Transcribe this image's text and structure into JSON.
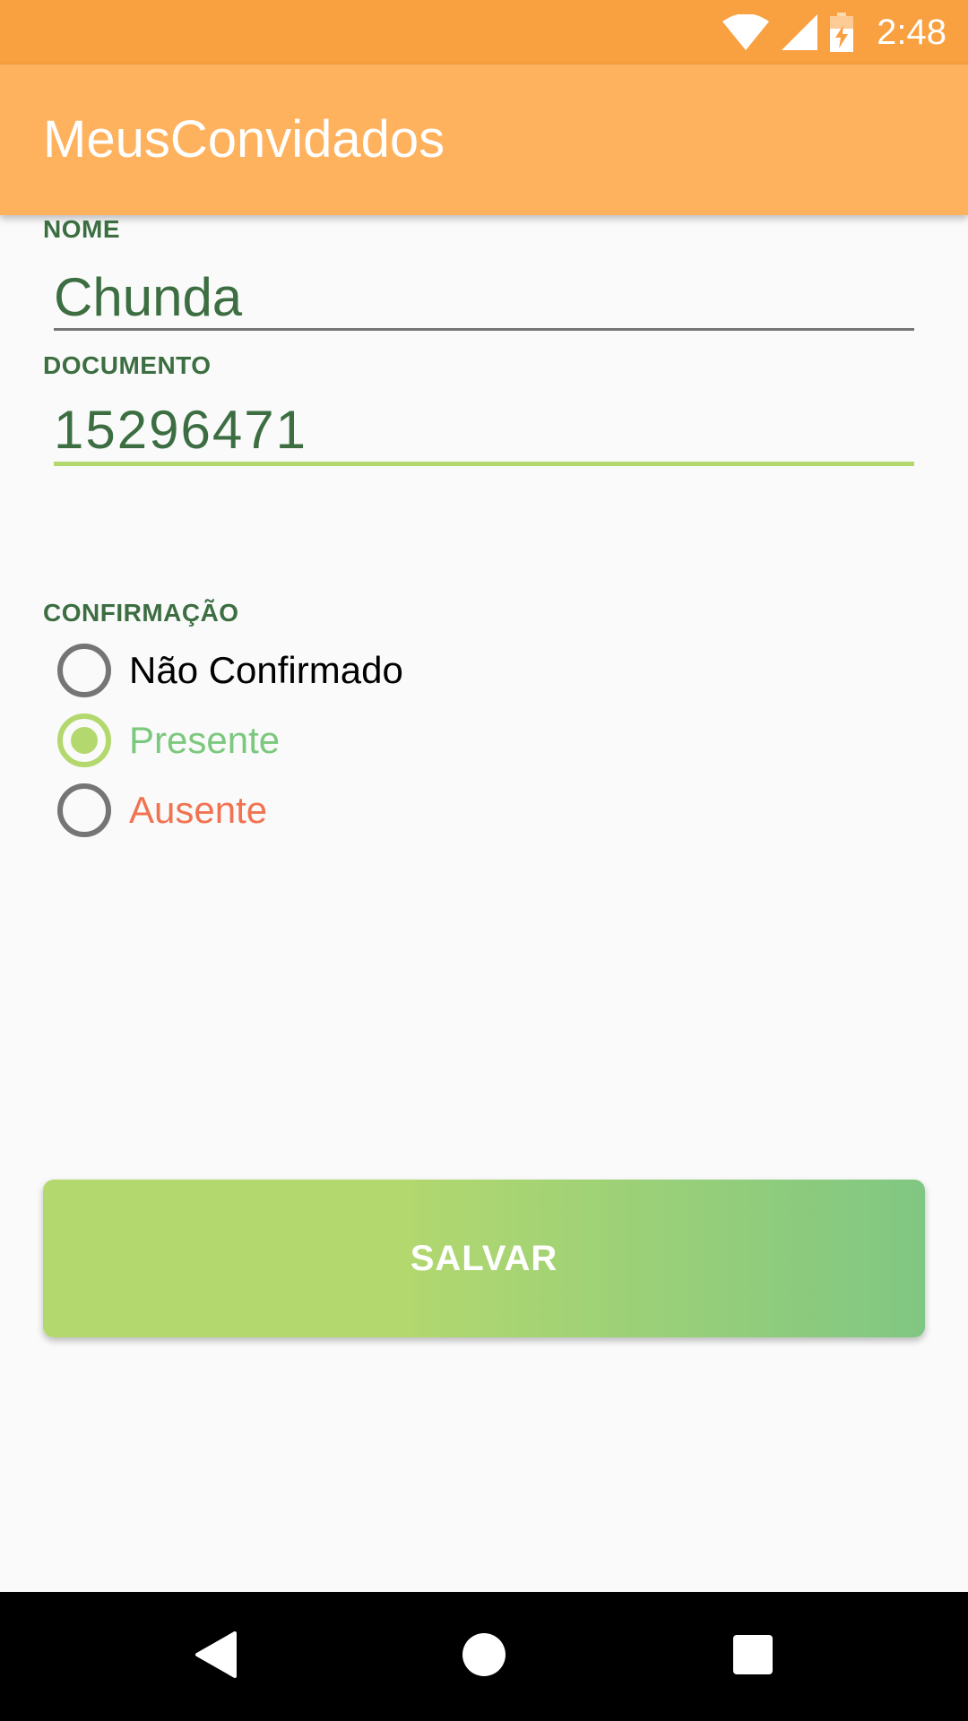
{
  "status_bar": {
    "time": "2:48",
    "icons": [
      "wifi-icon",
      "cell-signal-icon",
      "battery-charging-icon"
    ],
    "color": "#f9a040"
  },
  "app_bar": {
    "title": "MeusConvidados",
    "color": "#ffb25e"
  },
  "form": {
    "name_label": "NOME",
    "name_value": "Chunda",
    "document_label": "DOCUMENTO",
    "document_value": "15296471",
    "confirmation_label": "CONFIRMAÇÃO",
    "options": [
      {
        "label": "Não Confirmado",
        "checked": false,
        "color": "#000000"
      },
      {
        "label": "Presente",
        "checked": true,
        "color": "#7cc87e"
      },
      {
        "label": "Ausente",
        "checked": false,
        "color": "#f07352"
      }
    ],
    "accent_color": "#b3d86e",
    "label_color": "#3c6e42"
  },
  "save_button": {
    "label": "SALVAR"
  },
  "nav_bar": {
    "icons": [
      "back-icon",
      "home-icon",
      "recents-icon"
    ]
  }
}
